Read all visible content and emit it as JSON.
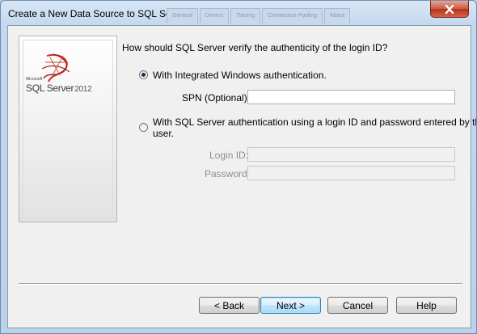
{
  "window": {
    "title": "Create a New Data Source to SQL Server",
    "background_tabs": [
      "General",
      "Drivers",
      "Tracing",
      "Connection Pooling",
      "About"
    ]
  },
  "logo": {
    "brand_small": "Microsoft",
    "product": "SQL Server",
    "version": "2012"
  },
  "form": {
    "question": "How should SQL Server verify the authenticity of the login ID?",
    "option_windows_label": "With Integrated Windows authentication.",
    "option_windows_selected": true,
    "spn_label": "SPN (Optional):",
    "spn_value": "",
    "option_sql_label_line1": "With SQL Server authentication using a login ID and password entered by the",
    "option_sql_label_line2": "user.",
    "option_sql_selected": false,
    "login_label": "Login ID:",
    "login_value": "",
    "password_label": "Password:",
    "password_value": ""
  },
  "buttons": {
    "back": "< Back",
    "next": "Next >",
    "cancel": "Cancel",
    "help": "Help"
  },
  "colors": {
    "title_bar": "#c4d8ee",
    "close_button": "#c75a43",
    "client_bg": "#f0f0f0"
  }
}
